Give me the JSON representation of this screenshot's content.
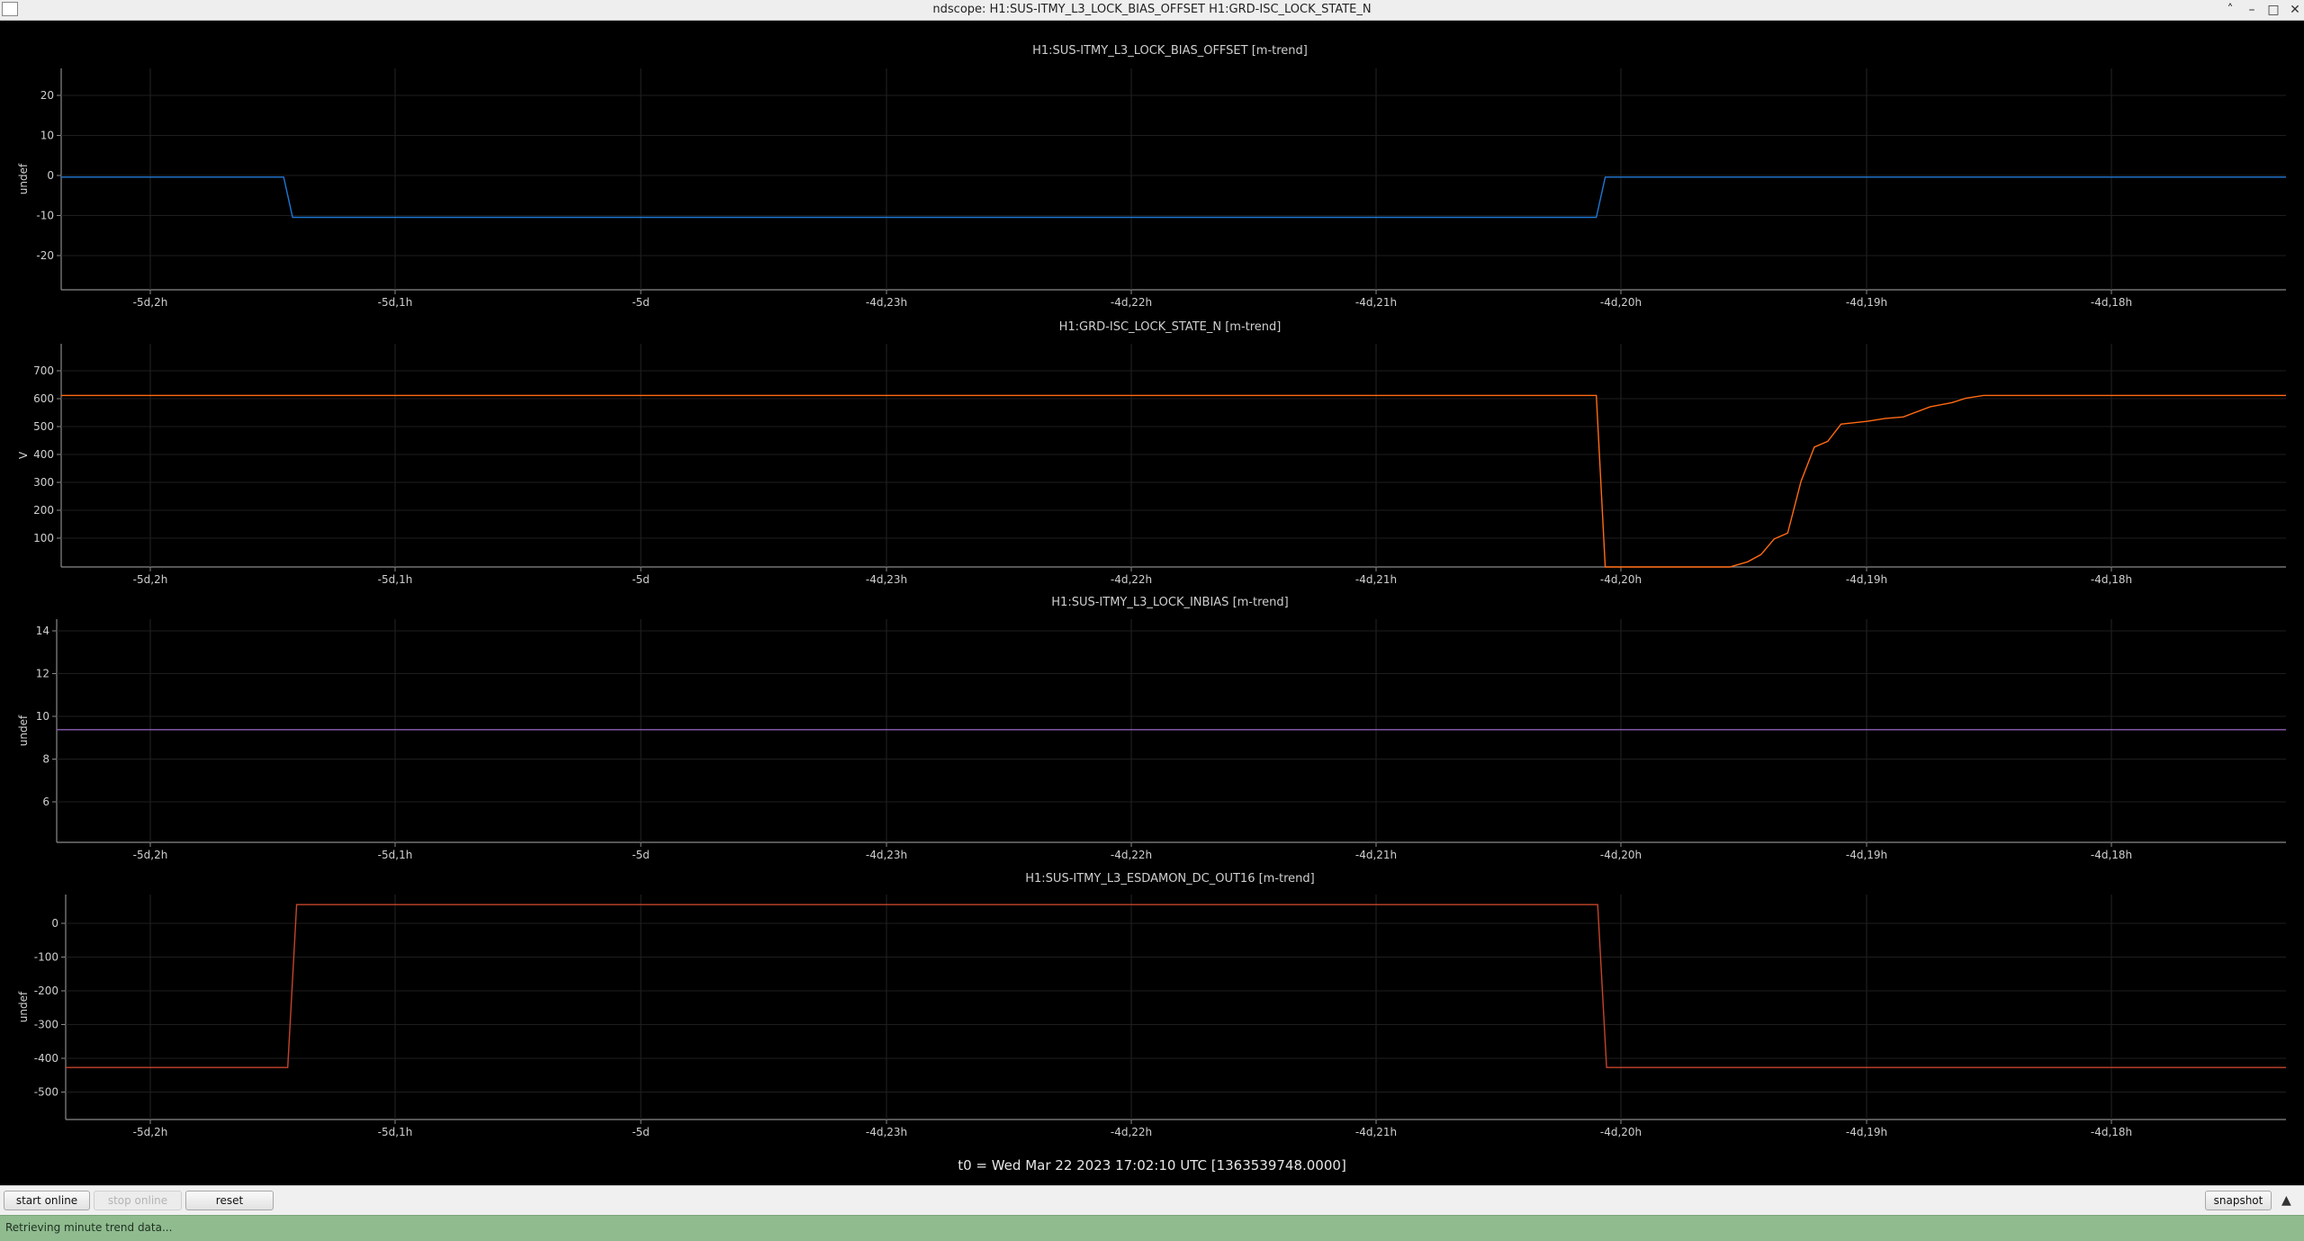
{
  "window": {
    "title": "ndscope: H1:SUS-ITMY_L3_LOCK_BIAS_OFFSET H1:GRD-ISC_LOCK_STATE_N"
  },
  "titlebar_buttons": [
    "chevron-up-icon",
    "minimize-icon",
    "maximize-icon",
    "close-icon"
  ],
  "time_ticks": [
    "-5d,2h",
    "-5d,1h",
    "-5d",
    "-4d,23h",
    "-4d,22h",
    "-4d,21h",
    "-4d,20h",
    "-4d,19h",
    "-4d,18h"
  ],
  "t0_label": "t0 = Wed Mar 22 2023 17:02:10 UTC [1363539748.0000]",
  "buttons": {
    "start_online": "start online",
    "stop_online": "stop online",
    "reset": "reset",
    "snapshot": "snapshot"
  },
  "status": "Retrieving minute trend data...",
  "colors": {
    "bias_offset": "#1f77d4",
    "lock_state": "#ff6a13",
    "inbias": "#8c5fb3",
    "esdamon": "#c4442c"
  },
  "chart_data": [
    {
      "type": "line",
      "title": "H1:SUS-ITMY_L3_LOCK_BIAS_OFFSET [m-trend]",
      "ylabel": "undef",
      "yticks": [
        "20",
        "10",
        "0",
        "-10",
        "-20"
      ],
      "ylim": [
        -28,
        27
      ],
      "xlim": [
        -5.1,
        -4.6
      ],
      "series": [
        {
          "x": [
            -5.1,
            -5.05,
            -5.048,
            -4.755,
            -4.753,
            -4.6
          ],
          "y": [
            0,
            0,
            -10,
            -10,
            0,
            0
          ]
        }
      ]
    },
    {
      "type": "line",
      "title": "H1:GRD-ISC_LOCK_STATE_N [m-trend]",
      "ylabel": "V",
      "yticks": [
        "700",
        "600",
        "500",
        "400",
        "300",
        "200",
        "100"
      ],
      "ylim": [
        2,
        780
      ],
      "xlim": [
        -5.1,
        -4.6
      ],
      "series": [
        {
          "x": [
            -5.1,
            -4.755,
            -4.753,
            -4.725,
            -4.721,
            -4.718,
            -4.715,
            -4.712,
            -4.709,
            -4.706,
            -4.703,
            -4.7,
            -4.697,
            -4.694,
            -4.69,
            -4.686,
            -4.68,
            -4.675,
            -4.672,
            -4.668,
            -4.665,
            -4.6
          ],
          "y": [
            600,
            600,
            2,
            2,
            20,
            45,
            100,
            120,
            300,
            420,
            440,
            500,
            505,
            510,
            520,
            525,
            560,
            575,
            590,
            600,
            600,
            600
          ]
        }
      ]
    },
    {
      "type": "line",
      "title": "H1:SUS-ITMY_L3_LOCK_INBIAS [m-trend]",
      "ylabel": "undef",
      "yticks": [
        "14",
        "12",
        "10",
        "8",
        "6"
      ],
      "ylim": [
        4,
        14.5
      ],
      "xlim": [
        -5.1,
        -4.6
      ],
      "series": [
        {
          "x": [
            -5.1,
            -4.6
          ],
          "y": [
            9.3,
            9.3
          ]
        }
      ]
    },
    {
      "type": "line",
      "title": "H1:SUS-ITMY_L3_ESDAMON_DC_OUT16 [m-trend]",
      "ylabel": "undef",
      "yticks": [
        "0",
        "-100",
        "-200",
        "-300",
        "-400",
        "-500"
      ],
      "ylim": [
        -580,
        90
      ],
      "xlim": [
        -5.1,
        -4.6
      ],
      "series": [
        {
          "x": [
            -5.1,
            -5.05,
            -5.048,
            -4.755,
            -4.753,
            -4.6
          ],
          "y": [
            -425,
            -425,
            60,
            60,
            -425,
            -425
          ]
        }
      ]
    }
  ]
}
